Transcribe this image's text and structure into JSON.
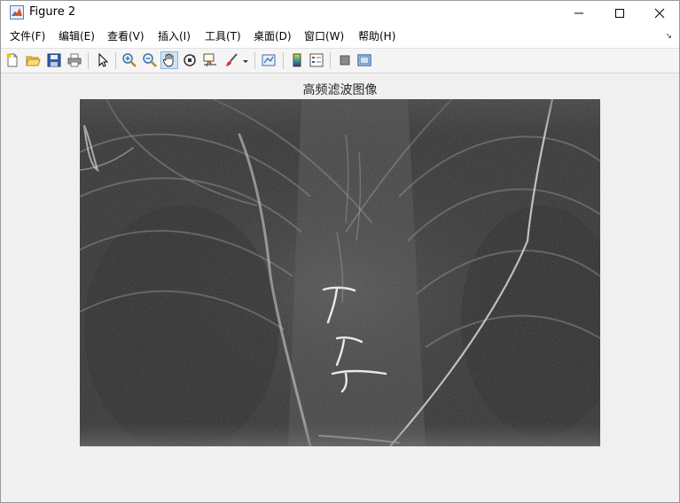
{
  "window": {
    "title": "Figure 2"
  },
  "menu": {
    "items": [
      "文件(F)",
      "编辑(E)",
      "查看(V)",
      "插入(I)",
      "工具(T)",
      "桌面(D)",
      "窗口(W)",
      "帮助(H)"
    ]
  },
  "toolbar": {
    "buttons": [
      "new-figure-icon",
      "open-file-icon",
      "save-icon",
      "print-icon",
      "edit-plot-arrow-icon",
      "zoom-in-icon",
      "zoom-out-icon",
      "pan-hand-icon",
      "rotate-3d-icon",
      "data-cursor-icon",
      "brush-icon",
      "link-plot-icon",
      "colorbar-icon",
      "legend-icon",
      "hide-plot-tools-icon",
      "show-plot-tools-icon"
    ],
    "active": "pan-hand-icon"
  },
  "figure": {
    "title": "高频滤波图像",
    "image": "grayscale high-frequency filtered image"
  },
  "colors": {
    "titlebar": "#ffffff",
    "background": "#f0f0f0",
    "image_dark": "#2e2e2e"
  }
}
